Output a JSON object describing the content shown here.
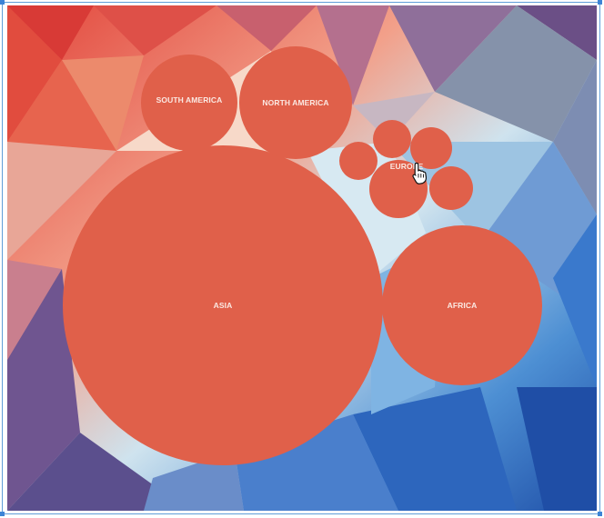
{
  "bubbles": [
    {
      "key": "asia",
      "label": "ASIA"
    },
    {
      "key": "africa",
      "label": "AFRICA"
    },
    {
      "key": "north-america",
      "label": "NORTH AMERICA"
    },
    {
      "key": "south-america",
      "label": "SOUTH AMERICA"
    },
    {
      "key": "europe",
      "label": "EUROPE"
    }
  ],
  "colors": {
    "bubble_fill": "#e0604a",
    "frame_border": "#5f9ed8",
    "handle": "#3d84d6"
  },
  "icons": {
    "cursor": "hand-pointer-icon"
  }
}
